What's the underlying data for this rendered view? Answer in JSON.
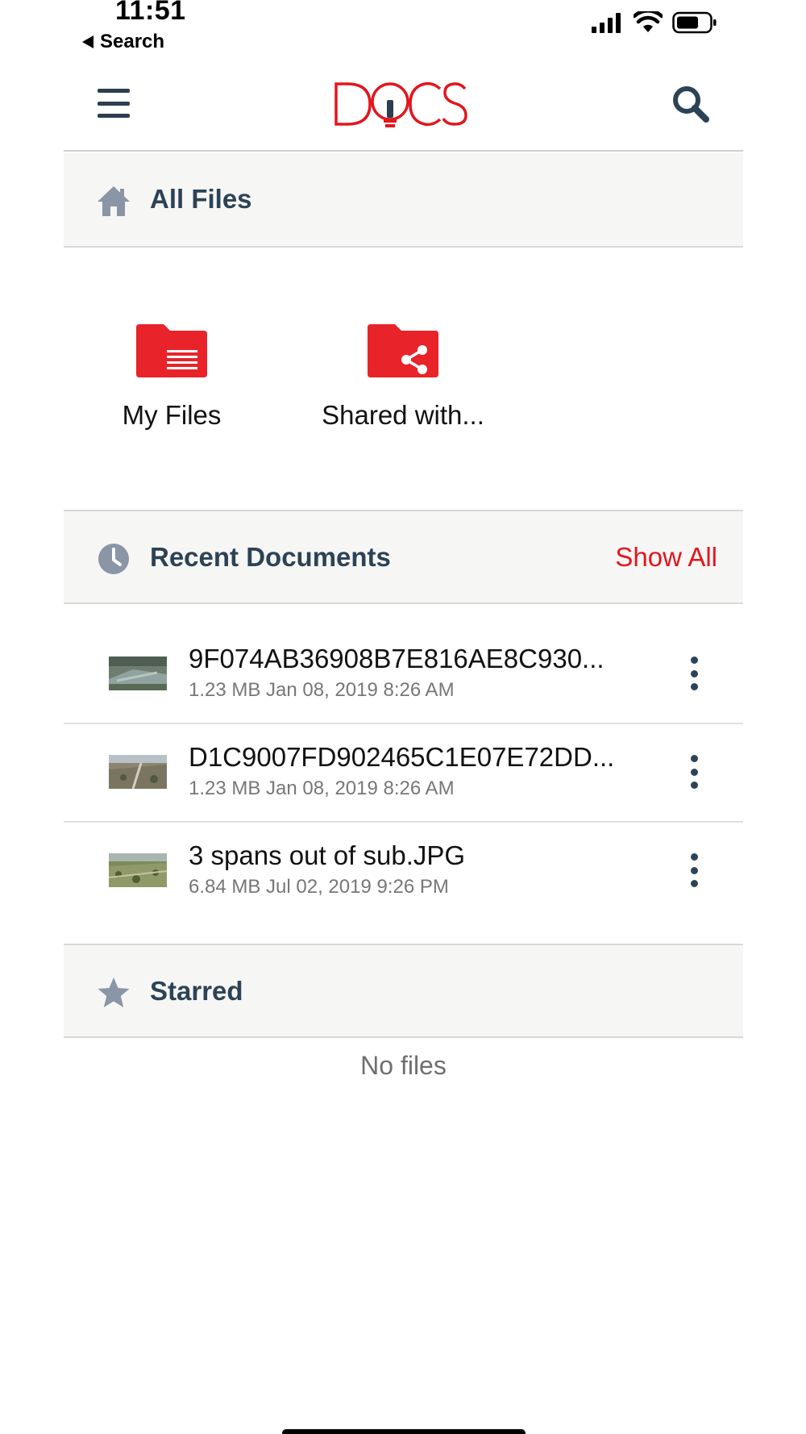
{
  "status_bar": {
    "time": "11:51",
    "back_label": "Search"
  },
  "header": {
    "logo_text": "DOCS",
    "icons": {
      "menu": "hamburger-menu-icon",
      "search": "search-icon"
    }
  },
  "all_files": {
    "title": "All Files",
    "icon": "home-icon",
    "folders": [
      {
        "label": "My Files",
        "icon": "folder-document-icon"
      },
      {
        "label": "Shared with...",
        "icon": "folder-share-icon"
      }
    ]
  },
  "recent": {
    "title": "Recent Documents",
    "icon": "clock-icon",
    "action": "Show All",
    "items": [
      {
        "name": "9F074AB36908B7E816AE8C930...",
        "meta": "1.23 MB Jan 08, 2019 8:26 AM"
      },
      {
        "name": "D1C9007FD902465C1E07E72DD...",
        "meta": "1.23 MB Jan 08, 2019 8:26 AM"
      },
      {
        "name": "3 spans out of sub.JPG",
        "meta": "6.84 MB Jul 02, 2019 9:26 PM"
      }
    ]
  },
  "starred": {
    "title": "Starred",
    "icon": "star-icon",
    "empty_text": "No files"
  },
  "colors": {
    "brand_red": "#e3161c",
    "heading_navy": "#2c4356",
    "section_bg": "#f6f6f5",
    "icon_grey": "#8a95a6"
  }
}
